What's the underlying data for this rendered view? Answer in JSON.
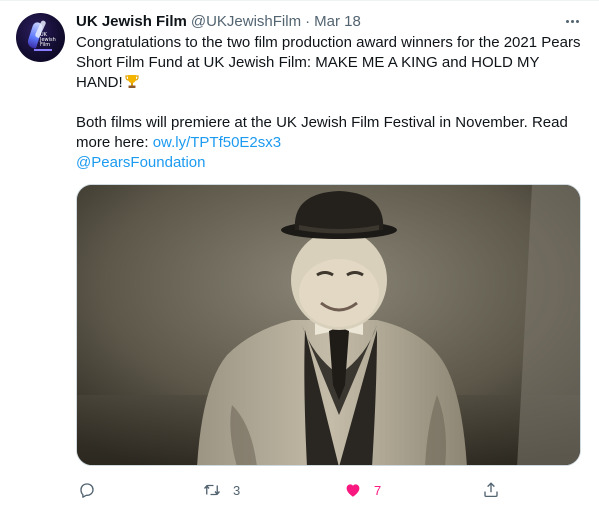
{
  "tweet": {
    "display_name": "UK Jewish Film",
    "handle": "@UKJewishFilm",
    "separator": "·",
    "date": "Mar 18",
    "avatar_icon": "uk-jewish-film-logo",
    "avatar_text": "UK Jewish Film",
    "body_line1": "Congratulations to the two film production award winners for the 2021 Pears Short Film Fund at UK Jewish Film: MAKE ME A KING and HOLD MY HAND!",
    "emoji": "trophy",
    "body_line2": "Both films will premiere at the UK Jewish Film Festival in November. Read more here:",
    "link_text": "ow.ly/TPTf50E2sx3",
    "mention": "@PearsFoundation"
  },
  "media": {
    "description_icon": "sepia-photo"
  },
  "actions": {
    "reply": {
      "icon": "reply-icon",
      "count": ""
    },
    "retweet": {
      "icon": "retweet-icon",
      "count": "3"
    },
    "like": {
      "icon": "heart-icon",
      "count": "7",
      "color": "#f91880"
    },
    "share": {
      "icon": "share-icon",
      "count": ""
    }
  },
  "colors": {
    "link": "#1d9bf0",
    "secondary_text": "#536471",
    "primary_text": "#0f1419",
    "like": "#f91880"
  }
}
